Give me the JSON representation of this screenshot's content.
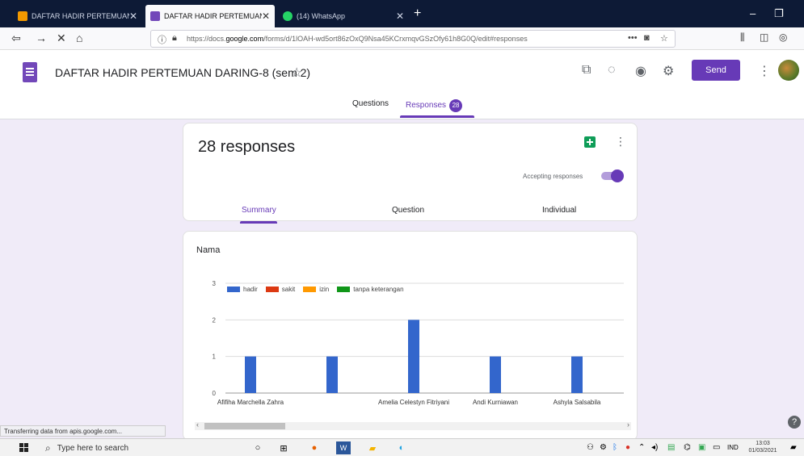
{
  "browser": {
    "tabs": [
      {
        "title": "DAFTAR HADIR PERTEMUAN D",
        "active": false,
        "color": "#f29900"
      },
      {
        "title": "DAFTAR HADIR PERTEMUAN D",
        "active": true,
        "color": "#7248b9"
      },
      {
        "title": "(14) WhatsApp",
        "active": false,
        "color": "#25d366"
      }
    ],
    "url_prefix": "https://docs.",
    "url_domain": "google.com",
    "url_rest": "/forms/d/1lOAH-wd5ort86zOxQ9Nsa45KCrxmqvGSzOfy61h8G0Q/edit#responses",
    "url_more": "•••"
  },
  "form": {
    "title": "DAFTAR HADIR PERTEMUAN DARING-8 (sem 2)",
    "send_label": "Send",
    "tabs": {
      "questions": "Questions",
      "responses": "Responses",
      "responses_badge": "28"
    }
  },
  "summary_card": {
    "count_text": "28 responses",
    "accepting_label": "Accepting responses",
    "accepting": true,
    "tabs": {
      "summary": "Summary",
      "question": "Question",
      "individual": "Individual"
    }
  },
  "question_card": {
    "title": "Nama"
  },
  "chart_data": {
    "type": "bar",
    "legend": [
      {
        "name": "hadir",
        "color": "#3366cc"
      },
      {
        "name": "sakit",
        "color": "#dc3912"
      },
      {
        "name": "izin",
        "color": "#ff9900"
      },
      {
        "name": "tanpa keterangan",
        "color": "#109618"
      }
    ],
    "categories": [
      "Afifiha Marchella Zahra",
      "",
      "Amelia Celestyn Fitriyani",
      "Andi Kurniawan",
      "Ashyla Salsabila"
    ],
    "series": [
      {
        "name": "hadir",
        "values": [
          1,
          1,
          2,
          1,
          1
        ]
      }
    ],
    "ylim": [
      0,
      3
    ],
    "yticks": [
      0,
      1,
      2,
      3
    ],
    "grid": true,
    "legend_position": "top"
  },
  "status_bar": {
    "text": "Transferring data from apis.google.com..."
  },
  "taskbar": {
    "search_placeholder": "Type here to search",
    "lang": "IND",
    "time": "13:03",
    "date": "01/03/2021"
  }
}
